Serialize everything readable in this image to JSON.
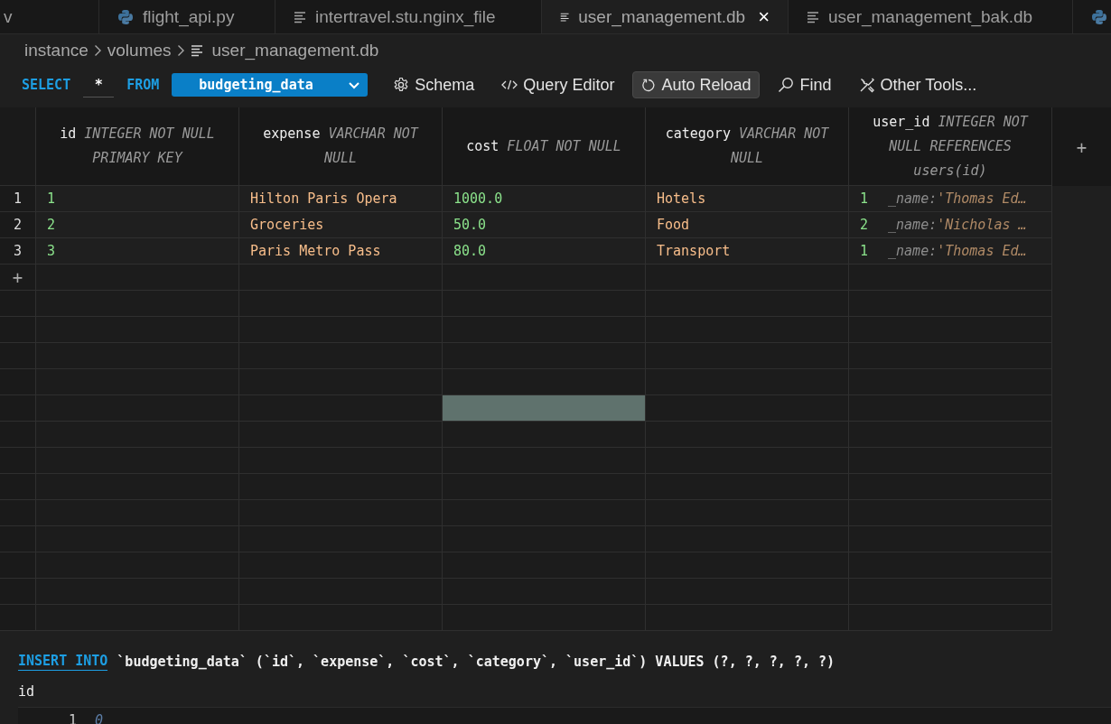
{
  "tabs": [
    {
      "label": "v",
      "kind": "none",
      "selected": false
    },
    {
      "label": "flight_api.py",
      "kind": "python",
      "selected": false
    },
    {
      "label": "intertravel.stu.nginx_file",
      "kind": "text",
      "selected": false
    },
    {
      "label": "user_management.db",
      "kind": "text",
      "selected": true
    },
    {
      "label": "user_management_bak.db",
      "kind": "text",
      "selected": false
    },
    {
      "kind": "python",
      "selected": false
    }
  ],
  "tab_close": "×",
  "breadcrumb": [
    "instance",
    "volumes",
    "user_management.db"
  ],
  "query_bar": {
    "select": "SELECT",
    "columns": "*",
    "from": "FROM",
    "table": "budgeting_data",
    "tools": [
      {
        "label": "Schema",
        "kind": "gear",
        "on": false
      },
      {
        "label": "Query Editor",
        "kind": "code",
        "on": false
      },
      {
        "label": "Auto Reload",
        "kind": "reload",
        "on": true
      },
      {
        "label": "Find",
        "kind": "search",
        "on": false
      },
      {
        "label": "Other Tools...",
        "kind": "tools",
        "on": false
      }
    ]
  },
  "table": {
    "columns": [
      {
        "name": "id",
        "type": "INTEGER NOT NULL PRIMARY KEY"
      },
      {
        "name": "expense",
        "type": "VARCHAR NOT NULL"
      },
      {
        "name": "cost",
        "type": "FLOAT NOT NULL"
      },
      {
        "name": "category",
        "type": "VARCHAR NOT NULL"
      },
      {
        "name": "user_id",
        "type": "INTEGER NOT NULL REFERENCES users(id)"
      }
    ],
    "add_column": "+",
    "rows": [
      {
        "number": "1",
        "cells": [
          {
            "kind": "number",
            "value": "1"
          },
          {
            "kind": "text",
            "value": "Hilton Paris Opera"
          },
          {
            "kind": "number",
            "value": "1000.0"
          },
          {
            "kind": "text",
            "value": "Hotels"
          },
          {
            "kind": "reference",
            "value": "1",
            "ref_label": "_name:",
            "ref_value": "'Thomas Ed…"
          }
        ]
      },
      {
        "number": "2",
        "cells": [
          {
            "kind": "number",
            "value": "2"
          },
          {
            "kind": "text",
            "value": "Groceries"
          },
          {
            "kind": "number",
            "value": "50.0"
          },
          {
            "kind": "text",
            "value": "Food"
          },
          {
            "kind": "reference",
            "value": "2",
            "ref_label": "_name:",
            "ref_value": "'Nicholas …"
          }
        ]
      },
      {
        "number": "3",
        "cells": [
          {
            "kind": "number",
            "value": "3"
          },
          {
            "kind": "text",
            "value": "Paris Metro Pass"
          },
          {
            "kind": "number",
            "value": "80.0"
          },
          {
            "kind": "text",
            "value": "Transport"
          },
          {
            "kind": "reference",
            "value": "1",
            "ref_label": "_name:",
            "ref_value": "'Thomas Ed…"
          }
        ]
      }
    ],
    "add_row": "+",
    "blank_rows": [
      {
        "cells": [
          {
            "selected": false
          },
          {
            "selected": false
          },
          {
            "selected": false
          },
          {
            "selected": false
          },
          {
            "selected": false
          }
        ]
      },
      {
        "cells": [
          {
            "selected": false
          },
          {
            "selected": false
          },
          {
            "selected": false
          },
          {
            "selected": false
          },
          {
            "selected": false
          }
        ]
      },
      {
        "cells": [
          {
            "selected": false
          },
          {
            "selected": false
          },
          {
            "selected": false
          },
          {
            "selected": false
          },
          {
            "selected": false
          }
        ]
      },
      {
        "cells": [
          {
            "selected": false
          },
          {
            "selected": false
          },
          {
            "selected": false
          },
          {
            "selected": false
          },
          {
            "selected": false
          }
        ]
      },
      {
        "cells": [
          {
            "selected": false
          },
          {
            "selected": false
          },
          {
            "selected": true
          },
          {
            "selected": false
          },
          {
            "selected": false
          }
        ]
      },
      {
        "cells": [
          {
            "selected": false
          },
          {
            "selected": false
          },
          {
            "selected": false
          },
          {
            "selected": false
          },
          {
            "selected": false
          }
        ]
      },
      {
        "cells": [
          {
            "selected": false
          },
          {
            "selected": false
          },
          {
            "selected": false
          },
          {
            "selected": false
          },
          {
            "selected": false
          }
        ]
      },
      {
        "cells": [
          {
            "selected": false
          },
          {
            "selected": false
          },
          {
            "selected": false
          },
          {
            "selected": false
          },
          {
            "selected": false
          }
        ]
      },
      {
        "cells": [
          {
            "selected": false
          },
          {
            "selected": false
          },
          {
            "selected": false
          },
          {
            "selected": false
          },
          {
            "selected": false
          }
        ]
      },
      {
        "cells": [
          {
            "selected": false
          },
          {
            "selected": false
          },
          {
            "selected": false
          },
          {
            "selected": false
          },
          {
            "selected": false
          }
        ]
      },
      {
        "cells": [
          {
            "selected": false
          },
          {
            "selected": false
          },
          {
            "selected": false
          },
          {
            "selected": false
          },
          {
            "selected": false
          }
        ]
      },
      {
        "cells": [
          {
            "selected": false
          },
          {
            "selected": false
          },
          {
            "selected": false
          },
          {
            "selected": false
          },
          {
            "selected": false
          }
        ]
      },
      {
        "cells": [
          {
            "selected": false
          },
          {
            "selected": false
          },
          {
            "selected": false
          },
          {
            "selected": false
          },
          {
            "selected": false
          }
        ]
      }
    ]
  },
  "insert": {
    "keyword": "INSERT INTO",
    "statement": "`budgeting_data` (`id`, `expense`, `cost`, `category`, `user_id`) VALUES (?, ?, ?, ?, ?)",
    "field_label": "id",
    "line_number": "1",
    "placeholder": "0"
  }
}
